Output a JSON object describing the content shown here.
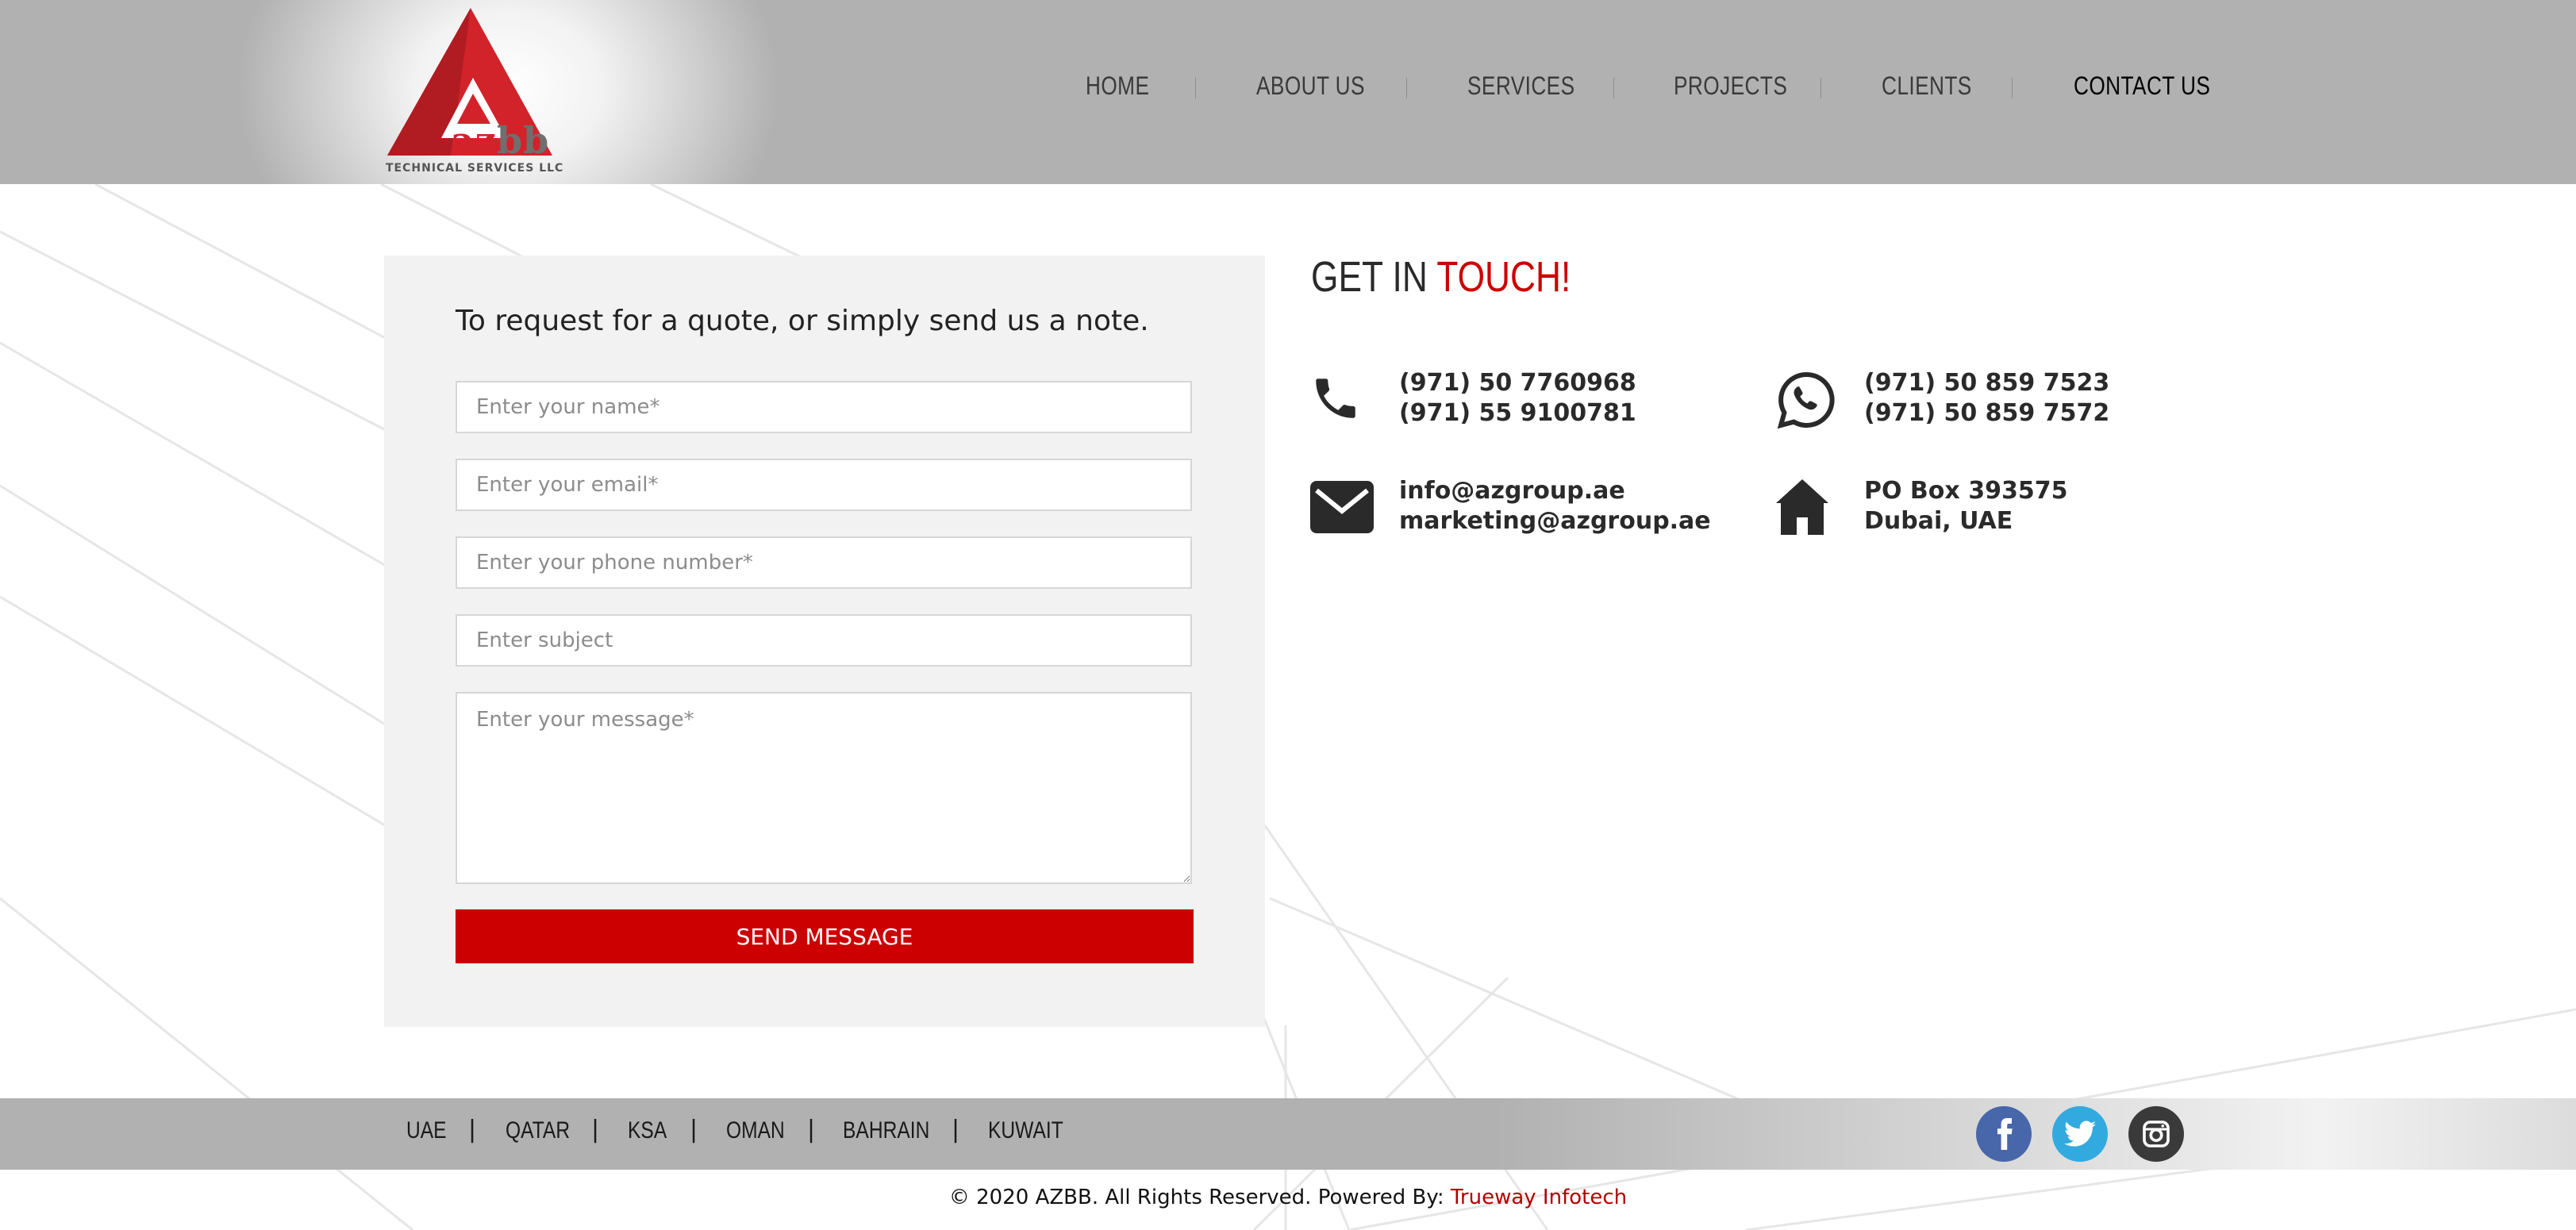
{
  "brand": {
    "logo_text_az": "az",
    "logo_text_bb": "bb",
    "logo_subtitle": "TECHNICAL SERVICES LLC",
    "colors": {
      "accent": "#cc0000",
      "header_bg": "#b1b1b1",
      "panel_bg": "#f2f2f2"
    }
  },
  "nav": {
    "items": [
      {
        "label": "HOME"
      },
      {
        "label": "ABOUT US"
      },
      {
        "label": "SERVICES"
      },
      {
        "label": "PROJECTS"
      },
      {
        "label": "CLIENTS"
      },
      {
        "label": "CONTACT US",
        "active": true
      }
    ]
  },
  "form": {
    "heading": "To request for a quote, or simply send us a note.",
    "name_placeholder": "Enter your name*",
    "email_placeholder": "Enter your email*",
    "phone_placeholder": "Enter your phone number*",
    "subject_placeholder": "Enter subject",
    "message_placeholder": "Enter your message*",
    "submit_label": "SEND MESSAGE"
  },
  "contact": {
    "title_part1": "GET IN",
    "title_part2": "TOUCH!",
    "phone": {
      "icon": "phone-icon",
      "line1": "(971) 50 7760968",
      "line2": "(971) 55 9100781"
    },
    "whatsapp": {
      "icon": "whatsapp-icon",
      "line1": "(971) 50 859 7523",
      "line2": "(971) 50 859 7572"
    },
    "email": {
      "icon": "envelope-icon",
      "line1": "info@azgroup.ae",
      "line2": "marketing@azgroup.ae"
    },
    "address": {
      "icon": "home-icon",
      "line1": "PO Box 393575",
      "line2": "Dubai, UAE"
    }
  },
  "footer": {
    "countries": [
      "UAE",
      "QATAR",
      "KSA",
      "OMAN",
      "BAHRAIN",
      "KUWAIT"
    ],
    "separator": "|",
    "social": [
      {
        "icon": "facebook-icon",
        "color": "#4867aa"
      },
      {
        "icon": "twitter-icon",
        "color": "#33aadf"
      },
      {
        "icon": "instagram-icon",
        "color": "#3a3a3a"
      }
    ],
    "copyright_prefix": "© 2020 AZBB. All Rights Reserved. Powered By:",
    "powered_by": "Trueway Infotech"
  }
}
